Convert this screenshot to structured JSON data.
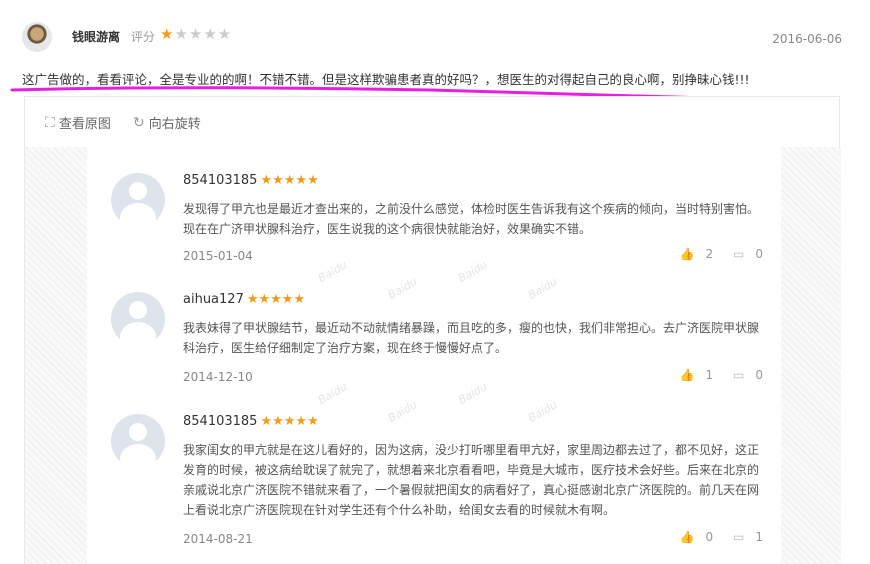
{
  "review": {
    "username": "钱眼游离",
    "score_label": "评分",
    "rating": 1,
    "rating_max": 5,
    "date": "2016-06-06",
    "text": "这广告做的，看看评论，全是专业的的啊！不错不错。但是这样欺骗患者真的好吗？，想医生的对得起自己的良心啊，别挣昧心钱!!!",
    "highlight_color": "#e81fe1"
  },
  "toolbar": {
    "view_original_label": "查看原图",
    "rotate_right_label": "向右旋转",
    "view_original_icon": "expand-icon",
    "rotate_right_icon": "rotate-right-icon"
  },
  "watermark_text": "Baidu",
  "comments": [
    {
      "name": "854103185",
      "stars": "★★★★★",
      "text": "发现得了甲亢也是最近才查出来的，之前没什么感觉，体检时医生告诉我有这个疾病的倾向，当时特别害怕。现在在广济甲状腺科治疗，医生说我的这个病很快就能治好，效果确实不错。",
      "date": "2015-01-04",
      "likes": "2",
      "replies": "0"
    },
    {
      "name": "aihua127",
      "stars": "★★★★★",
      "text": "我表妹得了甲状腺结节，最近动不动就情绪暴躁，而且吃的多，瘦的也快，我们非常担心。去广济医院甲状腺科治疗，医生给仔细制定了治疗方案，现在终于慢慢好点了。",
      "date": "2014-12-10",
      "likes": "1",
      "replies": "0"
    },
    {
      "name": "854103185",
      "stars": "★★★★★",
      "text": "我家闺女的甲亢就是在这儿看好的，因为这病，没少打听哪里看甲亢好，家里周边都去过了，都不见好，这正发育的时候，被这病给耽误了就完了，就想着来北京看看吧，毕竟是大城市，医疗技术会好些。后来在北京的亲戚说北京广济医院不错就来看了，一个暑假就把闺女的病看好了，真心挺感谢北京广济医院的。前几天在网上看说北京广济医院现在针对学生还有个什么补助，给闺女去看的时候就木有啊。",
      "date": "2014-08-21",
      "likes": "0",
      "replies": "1"
    }
  ]
}
